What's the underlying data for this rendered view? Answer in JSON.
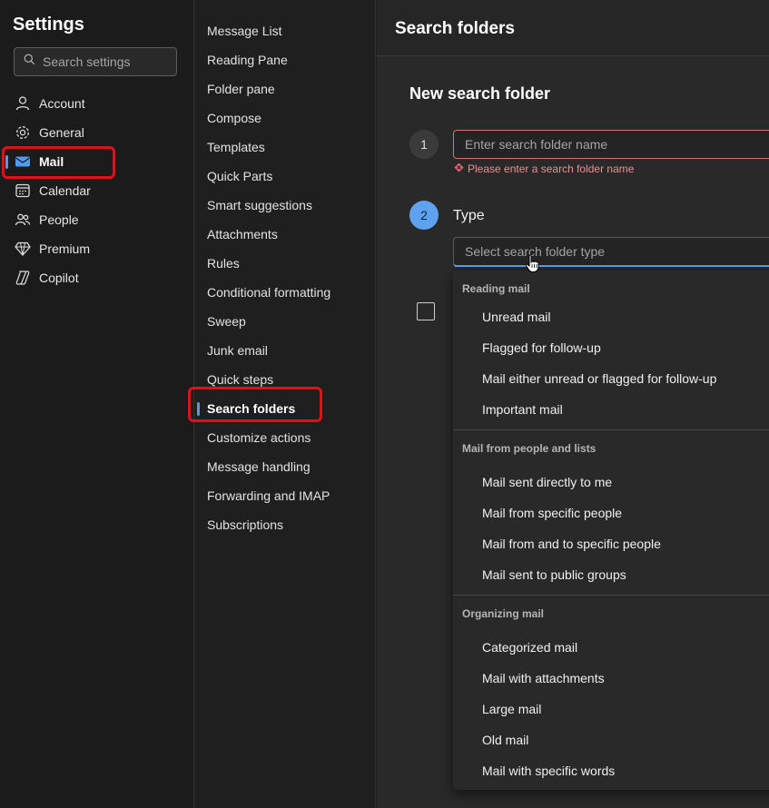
{
  "settings": {
    "title": "Settings",
    "search_placeholder": "Search settings",
    "nav": [
      {
        "label": "Account",
        "icon": "person-icon"
      },
      {
        "label": "General",
        "icon": "gear-icon"
      },
      {
        "label": "Mail",
        "icon": "mail-icon",
        "active": true
      },
      {
        "label": "Calendar",
        "icon": "calendar-icon"
      },
      {
        "label": "People",
        "icon": "people-icon"
      },
      {
        "label": "Premium",
        "icon": "diamond-icon"
      },
      {
        "label": "Copilot",
        "icon": "copilot-icon"
      }
    ]
  },
  "mail_settings": {
    "items": [
      "Message List",
      "Reading Pane",
      "Folder pane",
      "Compose",
      "Templates",
      "Quick Parts",
      "Smart suggestions",
      "Attachments",
      "Rules",
      "Conditional formatting",
      "Sweep",
      "Junk email",
      "Quick steps",
      "Search folders",
      "Customize actions",
      "Message handling",
      "Forwarding and IMAP",
      "Subscriptions"
    ],
    "active": "Search folders"
  },
  "content": {
    "title": "Search folders",
    "section_title": "New search folder",
    "step1": {
      "number": "1",
      "placeholder": "Enter search folder name",
      "error": "Please enter a search folder name"
    },
    "step2": {
      "number": "2",
      "label": "Type",
      "placeholder": "Select search folder type"
    },
    "dropdown": {
      "groups": [
        {
          "header": "Reading mail",
          "options": [
            "Unread mail",
            "Flagged for follow-up",
            "Mail either unread or flagged for follow-up",
            "Important mail"
          ]
        },
        {
          "header": "Mail from people and lists",
          "options": [
            "Mail sent directly to me",
            "Mail from specific people",
            "Mail from and to specific people",
            "Mail sent to public groups"
          ]
        },
        {
          "header": "Organizing mail",
          "options": [
            "Categorized mail",
            "Mail with attachments",
            "Large mail",
            "Old mail",
            "Mail with specific words"
          ]
        }
      ]
    }
  },
  "colors": {
    "accent": "#4f9bef",
    "highlight": "#e0101b",
    "error": "#f08c92"
  }
}
